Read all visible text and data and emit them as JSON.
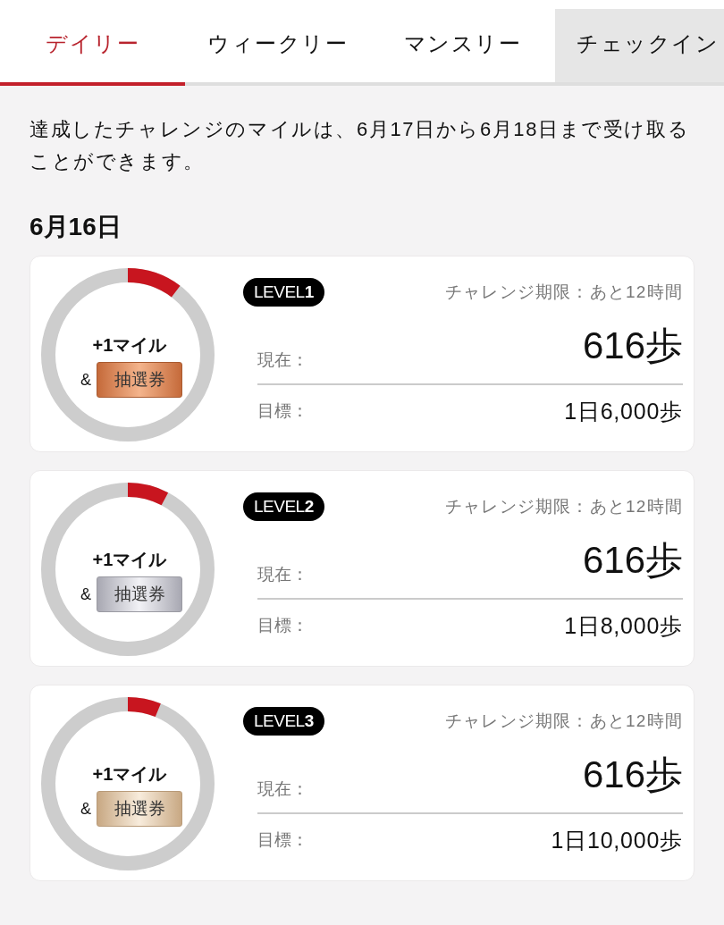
{
  "tabs": [
    {
      "label": "デイリー",
      "selected": true,
      "highlighted": false
    },
    {
      "label": "ウィークリー",
      "selected": false,
      "highlighted": false
    },
    {
      "label": "マンスリー",
      "selected": false,
      "highlighted": false
    },
    {
      "label": "チェックイン",
      "selected": false,
      "highlighted": true
    }
  ],
  "notice": "達成したチャレンジのマイルは、6月17日から6月18日まで受け取ることができます。",
  "date": "6月16日",
  "challenges": [
    {
      "level": 0.103,
      "reward": "+1マイル",
      "ampersand": "&",
      "ticket": {
        "label": "抽選券",
        "kind": "bronze"
      },
      "badge": "LEVEL**1**",
      "deadline": "チャレンジ期限：あと12時間",
      "current_label": "現在：",
      "current_value": "616歩",
      "goal_label": "目標：",
      "goal_value": "1日6,000歩"
    },
    {
      "level": 0.077,
      "reward": "+1マイル",
      "ampersand": "&",
      "ticket": {
        "label": "抽選券",
        "kind": "silver"
      },
      "badge": "LEVEL**2**",
      "deadline": "チャレンジ期限：あと12時間",
      "current_label": "現在：",
      "current_value": "616歩",
      "goal_label": "目標：",
      "goal_value": "1日8,000歩"
    },
    {
      "level": 0.062,
      "reward": "+1マイル",
      "ampersand": "&",
      "ticket": {
        "label": "抽選券",
        "kind": "gold"
      },
      "badge": "LEVEL**3**",
      "deadline": "チャレンジ期限：あと12時間",
      "current_label": "現在：",
      "current_value": "616歩",
      "goal_label": "目標：",
      "goal_value": "1日10,000歩"
    }
  ]
}
